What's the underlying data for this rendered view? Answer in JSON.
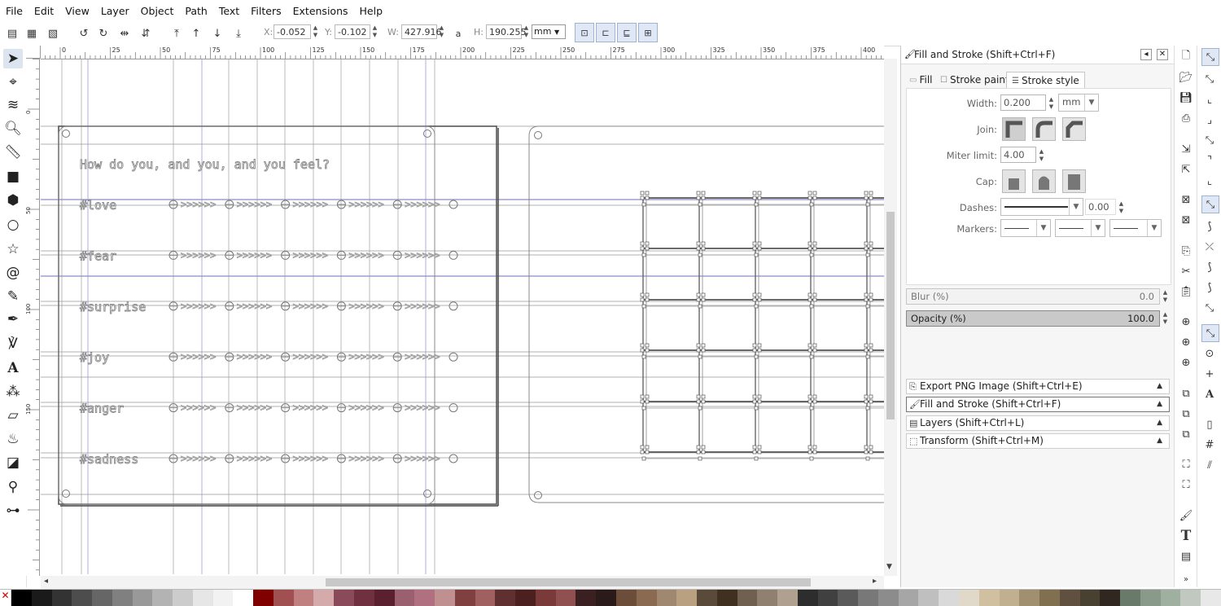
{
  "menu": [
    "File",
    "Edit",
    "View",
    "Layer",
    "Object",
    "Path",
    "Text",
    "Filters",
    "Extensions",
    "Help"
  ],
  "toolbar": {
    "x_label": "X:",
    "x_value": "-0.052",
    "y_label": "Y:",
    "y_value": "-0.102",
    "w_label": "W:",
    "w_value": "427.916",
    "h_label": "H:",
    "h_value": "190.255",
    "unit": "mm"
  },
  "ruler": {
    "h_labels": [
      "0",
      "25",
      "50",
      "75",
      "100",
      "125",
      "150",
      "175",
      "200",
      "225",
      "250",
      "275",
      "300",
      "325",
      "350",
      "375",
      "400"
    ],
    "v_labels": [
      "0",
      "50",
      "100",
      "150"
    ]
  },
  "canvas": {
    "question": "How do you, and you, and you feel?",
    "rows": [
      "#love",
      "#fear",
      "#surprise",
      "#joy",
      "#anger",
      "#sadness"
    ],
    "arrows": ">>>>>>"
  },
  "dock": {
    "title": "Fill and Stroke (Shift+Ctrl+F)",
    "tabs": {
      "fill": "Fill",
      "stroke_paint": "Stroke paint",
      "stroke_style": "Stroke style"
    },
    "width_label": "Width:",
    "width_value": "0.200",
    "width_unit": "mm",
    "join_label": "Join:",
    "miter_label": "Miter limit:",
    "miter_value": "4.00",
    "cap_label": "Cap:",
    "dashes_label": "Dashes:",
    "dashes_value": "0.00",
    "markers_label": "Markers:",
    "blur_label": "Blur (%)",
    "blur_value": "0.0",
    "opacity_label": "Opacity (%)",
    "opacity_value": "100.0",
    "opacity_fraction": 1.0,
    "panels": [
      "Export PNG Image (Shift+Ctrl+E)",
      "Fill and Stroke (Shift+Ctrl+F)",
      "Layers (Shift+Ctrl+L)",
      "Transform (Shift+Ctrl+M)"
    ]
  },
  "palette_colors": [
    "#000000",
    "#1a1a1a",
    "#333333",
    "#4d4d4d",
    "#666666",
    "#808080",
    "#999999",
    "#b3b3b3",
    "#cccccc",
    "#e6e6e6",
    "#f2f2f2",
    "#ffffff",
    "#800000",
    "#a05050",
    "#c08080",
    "#d4aaaa",
    "#8b4a5a",
    "#703040",
    "#5a2030",
    "#9a6070",
    "#b07080",
    "#c09090",
    "#804040",
    "#a06060",
    "#603030",
    "#4d2020",
    "#7a3a3a",
    "#905050",
    "#3a2020",
    "#2a1a1a",
    "#6b4d3a",
    "#8a6a50",
    "#a08870",
    "#b8a080",
    "#5a4a3a",
    "#403020",
    "#706050",
    "#908070",
    "#b0a090",
    "#2d2d2d",
    "#404040",
    "#5a5a5a",
    "#787878",
    "#8c8c8c",
    "#a6a6a6",
    "#bfbfbf",
    "#d9d9d9",
    "#e0d8c8",
    "#d0c0a0",
    "#c0b090",
    "#a09070",
    "#807050",
    "#605040",
    "#484030",
    "#302820",
    "#6a7a6a",
    "#8a9a8a",
    "#a0b0a0",
    "#c0c8c0",
    "#e8e8e8"
  ]
}
